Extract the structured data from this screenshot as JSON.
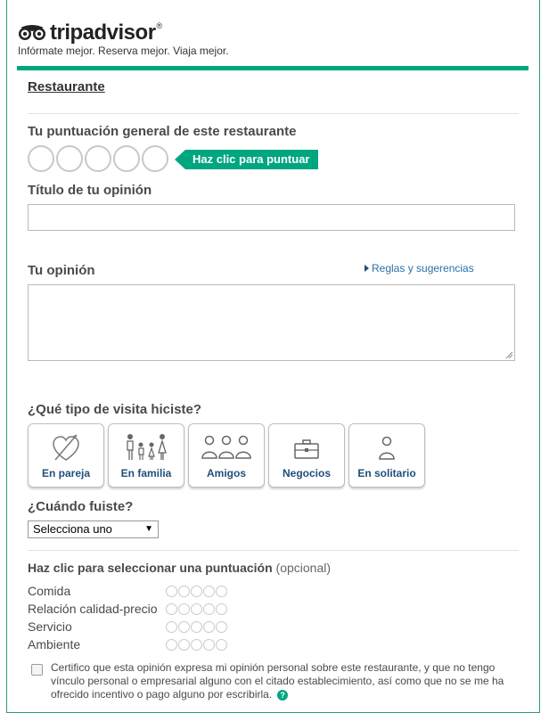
{
  "header": {
    "brand": "tripadvisor",
    "reg_mark": "®",
    "tagline": "Infórmate mejor. Reserva mejor. Viaja mejor."
  },
  "section_title": "Restaurante",
  "overall_rating": {
    "label": "Tu puntuación general de este restaurante",
    "prompt": "Haz clic para puntuar",
    "bubbles": 5
  },
  "review_title": {
    "label": "Título de tu opinión",
    "value": ""
  },
  "review_body": {
    "label": "Tu opinión",
    "value": "",
    "rules_link": "Reglas y sugerencias"
  },
  "visit_type": {
    "label": "¿Qué tipo de visita hiciste?",
    "options": [
      {
        "label": "En pareja",
        "icon": "heart-arrow-icon"
      },
      {
        "label": "En familia",
        "icon": "family-icon"
      },
      {
        "label": "Amigos",
        "icon": "friends-icon"
      },
      {
        "label": "Negocios",
        "icon": "briefcase-icon"
      },
      {
        "label": "En solitario",
        "icon": "person-icon"
      }
    ]
  },
  "visit_date": {
    "label": "¿Cuándo fuiste?",
    "selected": "Selecciona uno",
    "arrow": "▼"
  },
  "sub_ratings": {
    "label": "Haz clic para seleccionar una puntuación",
    "optional": "(opcional)",
    "items": [
      {
        "name": "Comida"
      },
      {
        "name": "Relación calidad-precio"
      },
      {
        "name": "Servicio"
      },
      {
        "name": "Ambiente"
      }
    ]
  },
  "certify": {
    "checked": false,
    "text": "Certifico que esta opinión expresa mi opinión personal sobre este restaurante, y que no tengo vínculo personal o empresarial alguno con el citado establecimiento, así como que no se me ha ofrecido incentivo o pago alguno por escribirla.",
    "help": "?"
  },
  "colors": {
    "accent": "#00a680",
    "link": "#1f4f7a",
    "bubble": "#c8c8c8"
  }
}
